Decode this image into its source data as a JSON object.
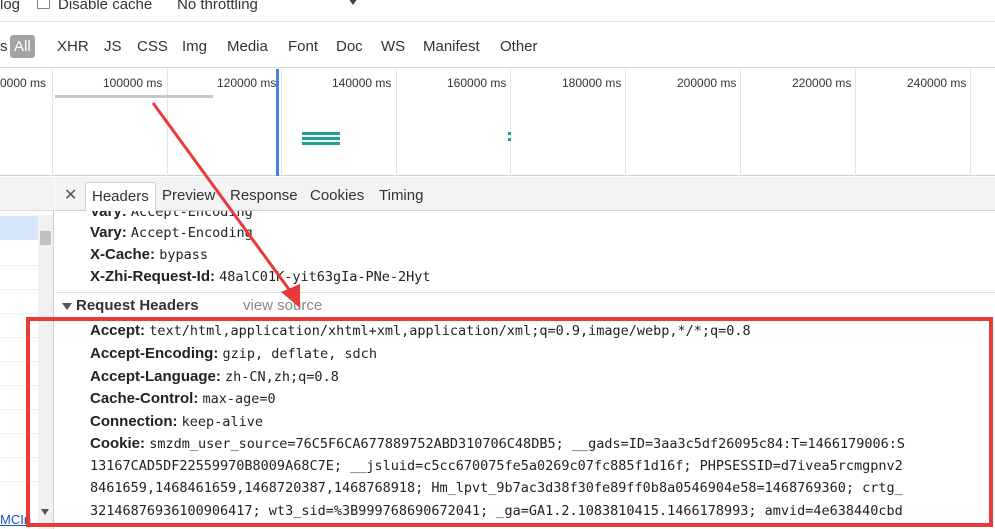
{
  "toolbar": {
    "log_label": "log",
    "disable_cache_label": "Disable cache",
    "throttling_value": "No throttling"
  },
  "filters": {
    "prefix": "s",
    "all": "All",
    "items": [
      "XHR",
      "JS",
      "CSS",
      "Img",
      "Media",
      "Font",
      "Doc",
      "WS",
      "Manifest",
      "Other"
    ]
  },
  "timeline": {
    "ticks": [
      "0000 ms",
      "100000 ms",
      "120000 ms",
      "140000 ms",
      "160000 ms",
      "180000 ms",
      "200000 ms",
      "220000 ms",
      "240000 ms"
    ]
  },
  "details": {
    "tabs": [
      "Headers",
      "Preview",
      "Response",
      "Cookies",
      "Timing"
    ],
    "response_headers": [
      {
        "key": "Vary:",
        "value": "Accept-Encoding"
      },
      {
        "key": "Vary:",
        "value": "Accept-Encoding"
      },
      {
        "key": "X-Cache:",
        "value": "bypass"
      },
      {
        "key": "X-Zhi-Request-Id:",
        "value": "48alC01K-yit63gIa-PNe-2Hyt"
      }
    ],
    "section_title": "Request Headers",
    "view_source": "view source",
    "request_headers": [
      {
        "key": "Accept:",
        "value": "text/html,application/xhtml+xml,application/xml;q=0.9,image/webp,*/*;q=0.8"
      },
      {
        "key": "Accept-Encoding:",
        "value": "gzip, deflate, sdch"
      },
      {
        "key": "Accept-Language:",
        "value": "zh-CN,zh;q=0.8"
      },
      {
        "key": "Cache-Control:",
        "value": "max-age=0"
      },
      {
        "key": "Connection:",
        "value": "keep-alive"
      },
      {
        "key": "Cookie:",
        "value": "smzdm_user_source=76C5F6CA677889752ABD310706C48DB5; __gads=ID=3aa3c5df26095c84:T=1466179006:S"
      }
    ],
    "cookie_continuation": [
      "13167CAD5DF22559970B8009A68C7E; __jsluid=c5cc670075fe5a0269c07fc885f1d16f; PHPSESSID=d7ivea5rcmgpnv2",
      "8461659,1468461659,1468720387,1468768918; Hm_lpvt_9b7ac3d38f30fe89ff0b8a0546904e58=1468769360; crtg_",
      "3214687693610090​6417; wt3_sid=%3B999768690672041; _ga=GA1.2.1083810415.1466178993; amvid=4e638440cbd"
    ]
  },
  "left_panel": {
    "link_text": "MCIn"
  },
  "annotation": {
    "color": "#e83a3a"
  }
}
